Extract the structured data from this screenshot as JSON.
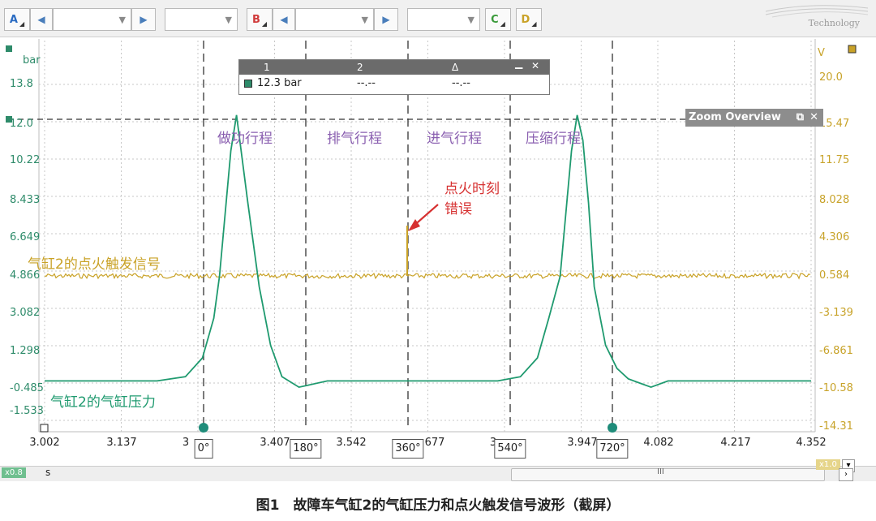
{
  "toolbar": {
    "channel_a": "A",
    "channel_b": "B",
    "channel_c": "C",
    "channel_d": "D",
    "brand": "Technology"
  },
  "chart_data": {
    "type": "line",
    "x_unit": "s",
    "x_ticks": [
      "3.002",
      "3.137",
      "3",
      "3.407",
      "3.542",
      "677",
      "3",
      "3.947",
      "4.082",
      "4.217",
      "4.352"
    ],
    "xlim": [
      3.002,
      4.352
    ],
    "left_axis": {
      "unit": "bar",
      "ticks": [
        "13.8",
        "12.0",
        "10.22",
        "8.433",
        "6.649",
        "4.866",
        "3.082",
        "1.298",
        "-0.485",
        "-1.533"
      ]
    },
    "right_axis": {
      "unit": "V",
      "ticks": [
        "20.0",
        "15.47",
        "11.75",
        "8.028",
        "4.306",
        "0.584",
        "-3.139",
        "-6.861",
        "-10.58",
        "-14.31"
      ]
    },
    "series": [
      {
        "name": "气缸2的气缸压力",
        "color": "#1f9a6f",
        "axis": "left",
        "x": [
          3.002,
          3.1,
          3.2,
          3.25,
          3.28,
          3.3,
          3.31,
          3.32,
          3.33,
          3.34,
          3.36,
          3.38,
          3.4,
          3.42,
          3.45,
          3.5,
          3.6,
          3.7,
          3.8,
          3.84,
          3.87,
          3.89,
          3.91,
          3.92,
          3.93,
          3.94,
          3.95,
          3.96,
          3.97,
          3.99,
          4.01,
          4.03,
          4.05,
          4.07,
          4.1,
          4.2,
          4.352
        ],
        "y": [
          -0.5,
          -0.5,
          -0.5,
          -0.3,
          0.6,
          2.5,
          4.5,
          7.5,
          10.5,
          12.2,
          8.0,
          4.0,
          1.2,
          -0.3,
          -0.8,
          -0.5,
          -0.5,
          -0.5,
          -0.5,
          -0.3,
          0.6,
          2.5,
          4.5,
          7.5,
          10.5,
          12.2,
          11.0,
          8.0,
          4.0,
          1.2,
          0.1,
          -0.4,
          -0.6,
          -0.8,
          -0.5,
          -0.5,
          -0.5
        ]
      },
      {
        "name": "气缸2的点火触发信号",
        "color": "#c9a227",
        "axis": "right",
        "baseline_v": 0.0,
        "spike_at": [
          3.625
        ],
        "spike_top_v": 5.6
      }
    ],
    "cursor_angles": [
      "0°",
      "180°",
      "360°",
      "540°",
      "720°"
    ],
    "stages": [
      "做功行程",
      "排气行程",
      "进气行程",
      "压缩行程"
    ],
    "annotation": [
      "点火时刻",
      "错误"
    ],
    "crosshair_level_bar": 12.0
  },
  "measurement": {
    "col1": "1",
    "col2": "2",
    "col3": "Δ",
    "row1_val1": "12.3 bar",
    "row1_val2": "--.--",
    "row1_val3": "--.--"
  },
  "zoom_overview": "Zoom Overview",
  "scroll": {
    "left_zoom": "x0.8",
    "unit": "s",
    "right_zoom": "x1.0",
    "thumb": "III"
  },
  "caption": "图1　故障车气缸2的气缸压力和点火触发信号波形（截屏）"
}
